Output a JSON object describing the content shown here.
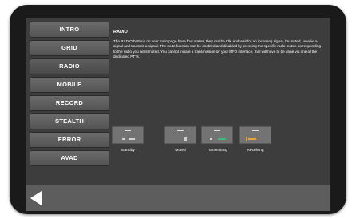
{
  "nav": {
    "items": [
      {
        "label": "INTRO"
      },
      {
        "label": "GRID"
      },
      {
        "label": "RADIO"
      },
      {
        "label": "MOBILE"
      },
      {
        "label": "RECORD"
      },
      {
        "label": "STEALTH"
      },
      {
        "label": "ERROR"
      },
      {
        "label": "AVAD"
      }
    ],
    "active": "RADIO"
  },
  "content": {
    "title": "RADIO",
    "description": "The RADIO buttons on your main page have four states, they can be Idle and wait for an incoming signal, be muted, receive a signal and transmit a signal. The mute function can be enabled and disabled by pressing the specific radio button corresponding to the radio you want muted. You cannot initiate a transmission on your MFD interface, that will have to be done via one of the dedicated PTTs."
  },
  "states": [
    {
      "label": "Standby",
      "indicator": "none"
    },
    {
      "label": "Muted",
      "indicator": "muted"
    },
    {
      "label": "Transmitting",
      "indicator": "transmit",
      "color": "#3fb87a"
    },
    {
      "label": "Receiving",
      "indicator": "receive",
      "color": "#e8a13a"
    }
  ],
  "bottom": {
    "back_icon": "back-arrow-icon"
  }
}
